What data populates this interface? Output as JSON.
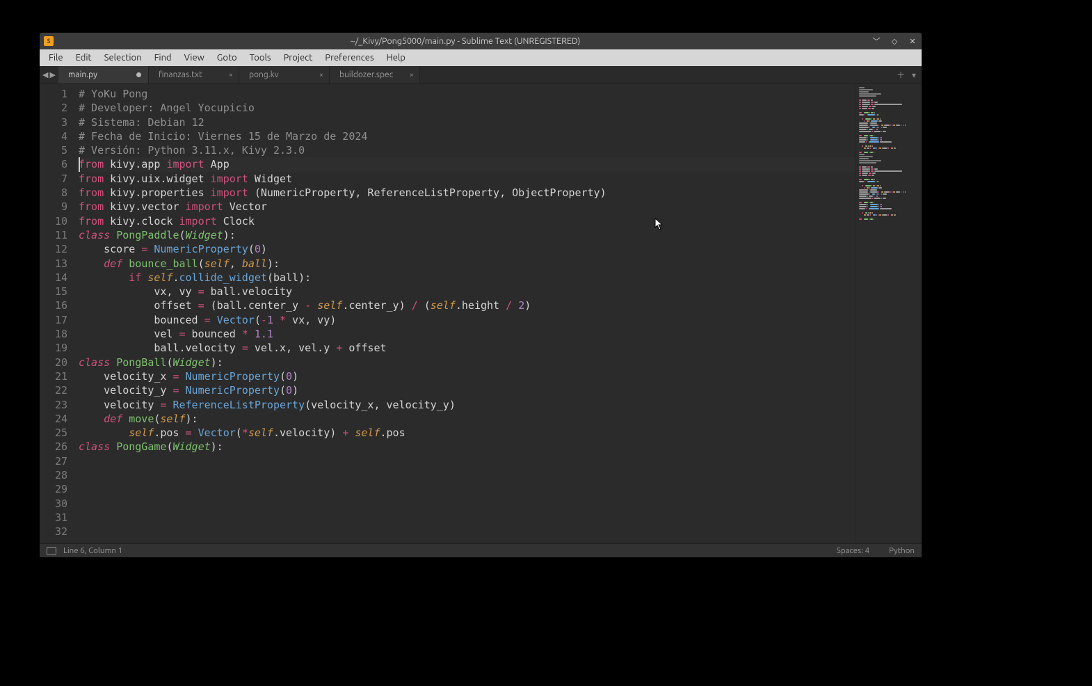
{
  "title": "~/_Kivy/Pong5000/main.py - Sublime Text (UNREGISTERED)",
  "menu": [
    "File",
    "Edit",
    "Selection",
    "Find",
    "View",
    "Goto",
    "Tools",
    "Project",
    "Preferences",
    "Help"
  ],
  "tabs": [
    {
      "label": "main.py",
      "active": true,
      "dirty": true
    },
    {
      "label": "finanzas.txt",
      "active": false,
      "dirty": false
    },
    {
      "label": "pong.kv",
      "active": false,
      "dirty": false
    },
    {
      "label": "buildozer.spec",
      "active": false,
      "dirty": false
    }
  ],
  "status": {
    "left": "Line 6, Column 1",
    "spaces": "Spaces: 4",
    "lang": "Python"
  },
  "code_lines": [
    {
      "n": 1,
      "tokens": [
        [
          "# YoKu Pong",
          "c-comment"
        ]
      ]
    },
    {
      "n": 2,
      "tokens": [
        [
          "# Developer: Angel Yocupicio",
          "c-comment"
        ]
      ]
    },
    {
      "n": 3,
      "tokens": [
        [
          "# Sistema: Debian 12",
          "c-comment"
        ]
      ]
    },
    {
      "n": 4,
      "tokens": [
        [
          "# Fecha de Inicio: Viernes 15 de Marzo de 2024",
          "c-comment"
        ]
      ]
    },
    {
      "n": 5,
      "tokens": [
        [
          "# Versión: Python 3.11.x, Kivy 2.3.0",
          "c-comment"
        ]
      ]
    },
    {
      "n": 6,
      "tokens": [
        [
          "",
          "c-text"
        ]
      ]
    },
    {
      "n": 7,
      "tokens": [
        [
          "from",
          "c-keyword"
        ],
        [
          " kivy.app ",
          "c-text"
        ],
        [
          "import",
          "c-keyword"
        ],
        [
          " App",
          "c-text"
        ]
      ]
    },
    {
      "n": 8,
      "tokens": [
        [
          "from",
          "c-keyword"
        ],
        [
          " kivy.uix.widget ",
          "c-text"
        ],
        [
          "import",
          "c-keyword"
        ],
        [
          " Widget",
          "c-text"
        ]
      ]
    },
    {
      "n": 9,
      "tokens": [
        [
          "from",
          "c-keyword"
        ],
        [
          " kivy.properties ",
          "c-text"
        ],
        [
          "import",
          "c-keyword"
        ],
        [
          " (NumericProperty, ReferenceListProperty, ObjectProperty)",
          "c-text"
        ]
      ]
    },
    {
      "n": 10,
      "tokens": [
        [
          "from",
          "c-keyword"
        ],
        [
          " kivy.vector ",
          "c-text"
        ],
        [
          "import",
          "c-keyword"
        ],
        [
          " Vector",
          "c-text"
        ]
      ]
    },
    {
      "n": 11,
      "tokens": [
        [
          "from",
          "c-keyword"
        ],
        [
          " kivy.clock ",
          "c-text"
        ],
        [
          "import",
          "c-keyword"
        ],
        [
          " Clock",
          "c-text"
        ]
      ]
    },
    {
      "n": 12,
      "tokens": [
        [
          "",
          "c-text"
        ]
      ]
    },
    {
      "n": 13,
      "tokens": [
        [
          "class",
          "c-keyword2"
        ],
        [
          " ",
          "c-text"
        ],
        [
          "PongPaddle",
          "c-class"
        ],
        [
          "(",
          "c-text"
        ],
        [
          "Widget",
          "c-classit"
        ],
        [
          "):",
          "c-text"
        ]
      ]
    },
    {
      "n": 14,
      "tokens": [
        [
          "    score ",
          "c-text"
        ],
        [
          "=",
          "c-op"
        ],
        [
          " ",
          "c-text"
        ],
        [
          "NumericProperty",
          "c-call"
        ],
        [
          "(",
          "c-text"
        ],
        [
          "0",
          "c-num"
        ],
        [
          ")",
          "c-text"
        ]
      ]
    },
    {
      "n": 15,
      "tokens": [
        [
          "",
          "c-text"
        ]
      ]
    },
    {
      "n": 16,
      "tokens": [
        [
          "    ",
          "c-text"
        ],
        [
          "def",
          "c-keyword2"
        ],
        [
          " ",
          "c-text"
        ],
        [
          "bounce_ball",
          "c-func"
        ],
        [
          "(",
          "c-text"
        ],
        [
          "self",
          "c-self"
        ],
        [
          ", ",
          "c-text"
        ],
        [
          "ball",
          "c-param"
        ],
        [
          "):",
          "c-text"
        ]
      ]
    },
    {
      "n": 17,
      "tokens": [
        [
          "        ",
          "c-text"
        ],
        [
          "if",
          "c-keyword"
        ],
        [
          " ",
          "c-text"
        ],
        [
          "self",
          "c-self"
        ],
        [
          ".",
          "c-text"
        ],
        [
          "collide_widget",
          "c-call"
        ],
        [
          "(ball):",
          "c-text"
        ]
      ]
    },
    {
      "n": 18,
      "tokens": [
        [
          "            vx, vy ",
          "c-text"
        ],
        [
          "=",
          "c-op"
        ],
        [
          " ball.velocity",
          "c-text"
        ]
      ]
    },
    {
      "n": 19,
      "tokens": [
        [
          "            offset ",
          "c-text"
        ],
        [
          "=",
          "c-op"
        ],
        [
          " (ball.center_y ",
          "c-text"
        ],
        [
          "-",
          "c-op"
        ],
        [
          " ",
          "c-text"
        ],
        [
          "self",
          "c-self"
        ],
        [
          ".center_y) ",
          "c-text"
        ],
        [
          "/",
          "c-op"
        ],
        [
          " (",
          "c-text"
        ],
        [
          "self",
          "c-self"
        ],
        [
          ".height ",
          "c-text"
        ],
        [
          "/",
          "c-op"
        ],
        [
          " ",
          "c-text"
        ],
        [
          "2",
          "c-num"
        ],
        [
          ")",
          "c-text"
        ]
      ]
    },
    {
      "n": 20,
      "tokens": [
        [
          "            bounced ",
          "c-text"
        ],
        [
          "=",
          "c-op"
        ],
        [
          " ",
          "c-text"
        ],
        [
          "Vector",
          "c-call"
        ],
        [
          "(",
          "c-text"
        ],
        [
          "-",
          "c-op"
        ],
        [
          "1",
          "c-num"
        ],
        [
          " ",
          "c-text"
        ],
        [
          "*",
          "c-op"
        ],
        [
          " vx, vy)",
          "c-text"
        ]
      ]
    },
    {
      "n": 21,
      "tokens": [
        [
          "            vel ",
          "c-text"
        ],
        [
          "=",
          "c-op"
        ],
        [
          " bounced ",
          "c-text"
        ],
        [
          "*",
          "c-op"
        ],
        [
          " ",
          "c-text"
        ],
        [
          "1.1",
          "c-num"
        ]
      ]
    },
    {
      "n": 22,
      "tokens": [
        [
          "            ball.velocity ",
          "c-text"
        ],
        [
          "=",
          "c-op"
        ],
        [
          " vel.x, vel.y ",
          "c-text"
        ],
        [
          "+",
          "c-op"
        ],
        [
          " offset",
          "c-text"
        ]
      ]
    },
    {
      "n": 23,
      "tokens": [
        [
          "",
          "c-text"
        ]
      ]
    },
    {
      "n": 24,
      "tokens": [
        [
          "class",
          "c-keyword2"
        ],
        [
          " ",
          "c-text"
        ],
        [
          "PongBall",
          "c-class"
        ],
        [
          "(",
          "c-text"
        ],
        [
          "Widget",
          "c-classit"
        ],
        [
          "):",
          "c-text"
        ]
      ]
    },
    {
      "n": 25,
      "tokens": [
        [
          "    velocity_x ",
          "c-text"
        ],
        [
          "=",
          "c-op"
        ],
        [
          " ",
          "c-text"
        ],
        [
          "NumericProperty",
          "c-call"
        ],
        [
          "(",
          "c-text"
        ],
        [
          "0",
          "c-num"
        ],
        [
          ")",
          "c-text"
        ]
      ]
    },
    {
      "n": 26,
      "tokens": [
        [
          "    velocity_y ",
          "c-text"
        ],
        [
          "=",
          "c-op"
        ],
        [
          " ",
          "c-text"
        ],
        [
          "NumericProperty",
          "c-call"
        ],
        [
          "(",
          "c-text"
        ],
        [
          "0",
          "c-num"
        ],
        [
          ")",
          "c-text"
        ]
      ]
    },
    {
      "n": 27,
      "tokens": [
        [
          "    velocity ",
          "c-text"
        ],
        [
          "=",
          "c-op"
        ],
        [
          " ",
          "c-text"
        ],
        [
          "ReferenceListProperty",
          "c-call"
        ],
        [
          "(velocity_x, velocity_y)",
          "c-text"
        ]
      ]
    },
    {
      "n": 28,
      "tokens": [
        [
          "",
          "c-text"
        ]
      ]
    },
    {
      "n": 29,
      "tokens": [
        [
          "    ",
          "c-text"
        ],
        [
          "def",
          "c-keyword2"
        ],
        [
          " ",
          "c-text"
        ],
        [
          "move",
          "c-func"
        ],
        [
          "(",
          "c-text"
        ],
        [
          "self",
          "c-self"
        ],
        [
          "):",
          "c-text"
        ]
      ]
    },
    {
      "n": 30,
      "tokens": [
        [
          "        ",
          "c-text"
        ],
        [
          "self",
          "c-self"
        ],
        [
          ".pos ",
          "c-text"
        ],
        [
          "=",
          "c-op"
        ],
        [
          " ",
          "c-text"
        ],
        [
          "Vector",
          "c-call"
        ],
        [
          "(",
          "c-text"
        ],
        [
          "*",
          "c-op"
        ],
        [
          "self",
          "c-self"
        ],
        [
          ".velocity) ",
          "c-text"
        ],
        [
          "+",
          "c-op"
        ],
        [
          " ",
          "c-text"
        ],
        [
          "self",
          "c-self"
        ],
        [
          ".pos",
          "c-text"
        ]
      ]
    },
    {
      "n": 31,
      "tokens": [
        [
          "",
          "c-text"
        ]
      ]
    },
    {
      "n": 32,
      "tokens": [
        [
          "class",
          "c-keyword2"
        ],
        [
          " ",
          "c-text"
        ],
        [
          "PongGame",
          "c-class"
        ],
        [
          "(",
          "c-text"
        ],
        [
          "Widget",
          "c-classit"
        ],
        [
          "):",
          "c-text"
        ]
      ]
    }
  ],
  "caret_line_index": 5
}
